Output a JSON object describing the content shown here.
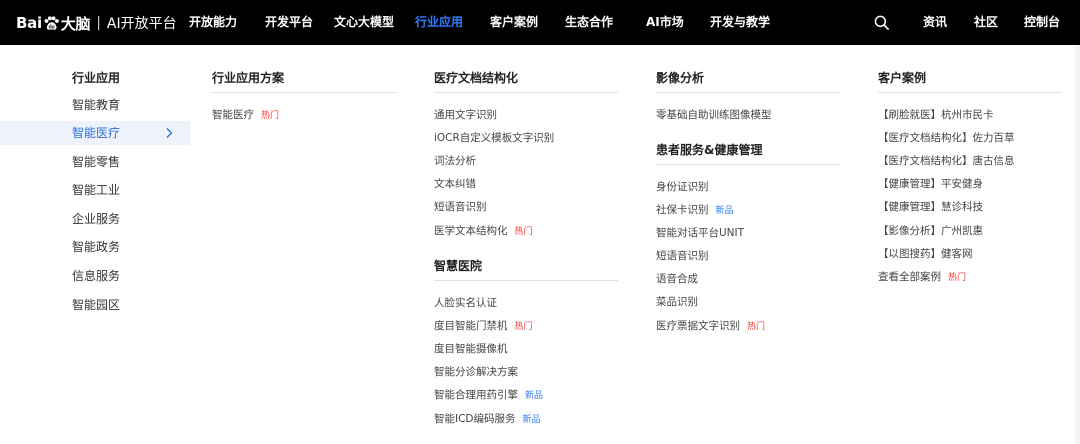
{
  "brand": {
    "logo_left": "Bai",
    "logo_right": "大脑",
    "separator": "|",
    "product": "AI开放平台"
  },
  "nav": {
    "items": [
      {
        "label": "开放能力"
      },
      {
        "label": "开发平台"
      },
      {
        "label": "文心大模型"
      },
      {
        "label": "行业应用"
      },
      {
        "label": "客户案例"
      },
      {
        "label": "生态合作"
      },
      {
        "label": "AI市场"
      },
      {
        "label": "开发与教学"
      }
    ],
    "active": "行业应用",
    "right": [
      {
        "label": "资讯"
      },
      {
        "label": "社区"
      },
      {
        "label": "控制台"
      }
    ]
  },
  "left_menu": {
    "title": "行业应用",
    "items": [
      {
        "label": "智能教育"
      },
      {
        "label": "智能医疗"
      },
      {
        "label": "智能零售"
      },
      {
        "label": "智能工业"
      },
      {
        "label": "企业服务"
      },
      {
        "label": "智能政务"
      },
      {
        "label": "信息服务"
      },
      {
        "label": "智能园区"
      }
    ],
    "selected": "智能医疗"
  },
  "tags": {
    "hot": "热门",
    "new": "新品"
  },
  "columns": {
    "solutions": {
      "title": "行业应用方案",
      "links": [
        {
          "label": "智能医疗",
          "tag": "hot"
        }
      ]
    },
    "doc": {
      "title": "医疗文档结构化",
      "links": [
        {
          "label": "通用文字识别",
          "tag": ""
        },
        {
          "label": "iOCR自定义模板文字识别",
          "tag": ""
        },
        {
          "label": "词法分析",
          "tag": ""
        },
        {
          "label": "文本纠错",
          "tag": ""
        },
        {
          "label": "短语音识别",
          "tag": ""
        },
        {
          "label": "医学文本结构化",
          "tag": "hot"
        }
      ]
    },
    "hospital": {
      "title": "智慧医院",
      "links": [
        {
          "label": "人脸实名认证",
          "tag": ""
        },
        {
          "label": "度目智能门禁机",
          "tag": "hot"
        },
        {
          "label": "度目智能摄像机",
          "tag": ""
        },
        {
          "label": "智能分诊解决方案",
          "tag": ""
        },
        {
          "label": "智能合理用药引擎",
          "tag": "new"
        },
        {
          "label": "智能ICD编码服务",
          "tag": "new"
        }
      ]
    },
    "imaging": {
      "title": "影像分析",
      "links": [
        {
          "label": "零基础自助训练图像模型",
          "tag": ""
        }
      ]
    },
    "patient": {
      "title": "患者服务&健康管理",
      "links": [
        {
          "label": "身份证识别",
          "tag": ""
        },
        {
          "label": "社保卡识别",
          "tag": "new"
        },
        {
          "label": "智能对话平台UNIT",
          "tag": ""
        },
        {
          "label": "短语音识别",
          "tag": ""
        },
        {
          "label": "语音合成",
          "tag": ""
        },
        {
          "label": "菜品识别",
          "tag": ""
        },
        {
          "label": "医疗票据文字识别",
          "tag": "hot"
        }
      ]
    },
    "cases": {
      "title": "客户案例",
      "links": [
        {
          "label": "【刷脸就医】杭州市民卡",
          "tag": ""
        },
        {
          "label": "【医疗文档结构化】佐力百草",
          "tag": ""
        },
        {
          "label": "【医疗文档结构化】唐古信息",
          "tag": ""
        },
        {
          "label": "【健康管理】平安健身",
          "tag": ""
        },
        {
          "label": "【健康管理】慧诊科技",
          "tag": ""
        },
        {
          "label": "【影像分析】广州凯惠",
          "tag": ""
        },
        {
          "label": "【以图搜药】健客网",
          "tag": ""
        },
        {
          "label": "查看全部案例",
          "tag": "hot"
        }
      ]
    }
  },
  "icons": {
    "search": "search-icon",
    "chevron": "chevron-right-icon",
    "logo": "baidu-paw-icon"
  },
  "colors": {
    "topbar": "#000000",
    "active_nav": "#2f7cff",
    "hot": "#ff3b30",
    "new": "#2f7cff",
    "selected_bg": "#eef3fb",
    "selected_text": "#2d6fe0"
  }
}
